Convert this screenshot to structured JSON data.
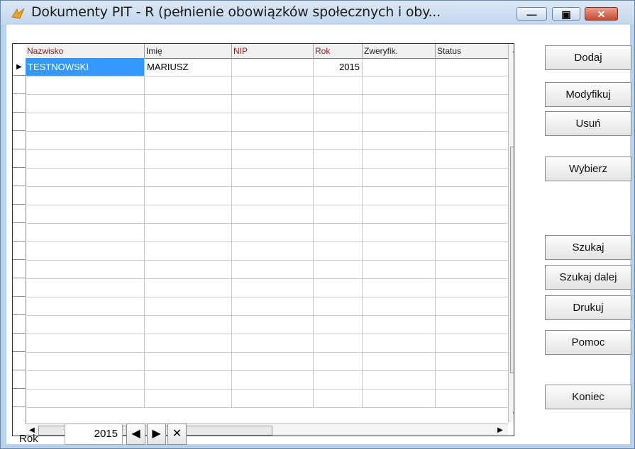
{
  "window": {
    "title": "Dokumenty PIT - R (pełnienie obowiązków społecznych i oby...",
    "min_glyph": "—",
    "max_glyph": "▣",
    "close_glyph": "✕",
    "accent": "#3399ff",
    "header_red": "#8a1b1b"
  },
  "grid": {
    "columns": [
      {
        "label": "Nazwisko",
        "color": "red"
      },
      {
        "label": "Imię",
        "color": "black"
      },
      {
        "label": "NIP",
        "color": "red"
      },
      {
        "label": "Rok",
        "color": "red"
      },
      {
        "label": "Zweryfik.",
        "color": "black"
      },
      {
        "label": "Status",
        "color": "black"
      }
    ],
    "rows": [
      {
        "nazwisko": "TESTNOWSKI",
        "imie": "MARIUSZ",
        "nip": "",
        "rok": "2015",
        "zweryfik": "",
        "status": ""
      }
    ],
    "current_row_marker": "▶",
    "scroll_up": "▲",
    "scroll_down": "▼",
    "scroll_left": "◀",
    "scroll_right": "▶"
  },
  "buttons": {
    "dodaj": "Dodaj",
    "modyfikuj": "Modyfikuj",
    "usun": "Usuń",
    "wybierz": "Wybierz",
    "szukaj": "Szukaj",
    "szukaj_dalej": "Szukaj dalej",
    "drukuj": "Drukuj",
    "pomoc": "Pomoc",
    "koniec": "Koniec"
  },
  "footer": {
    "rok_label": "Rok",
    "rok_value": "2015",
    "prev_glyph": "◀",
    "next_glyph": "▶",
    "clear_glyph": "✕"
  }
}
